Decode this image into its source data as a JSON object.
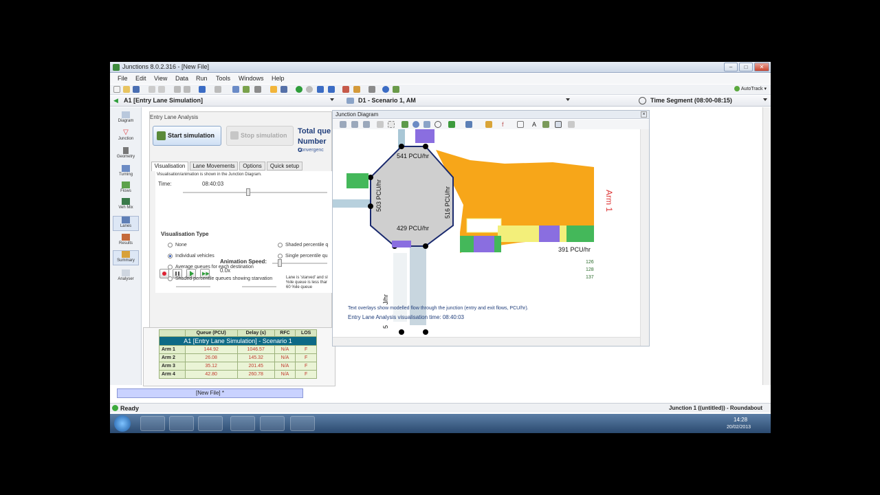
{
  "window": {
    "title": "Junctions 8.0.2.316 - [New File]"
  },
  "menu": [
    "File",
    "Edit",
    "View",
    "Data",
    "Run",
    "Tools",
    "Windows",
    "Help"
  ],
  "toolbar": {
    "autotrack": "AutoTrack"
  },
  "selectors": {
    "analysis": "A1 [Entry Lane Simulation]",
    "scenario": "D1 - Scenario 1, AM",
    "time_segment": "Time Segment (08:00-08:15)"
  },
  "nav": [
    {
      "label": "Diagram"
    },
    {
      "label": "Junction"
    },
    {
      "label": "Geometry"
    },
    {
      "label": "Turning"
    },
    {
      "label": "Flows"
    },
    {
      "label": "Veh Mix"
    },
    {
      "label": "Lanes"
    },
    {
      "label": "Results"
    },
    {
      "label": "Summary"
    },
    {
      "label": "Analyser"
    }
  ],
  "ela": {
    "title": "Entry Lane Analysis",
    "start": "Start simulation",
    "stop": "Stop simulation",
    "total": "Total que",
    "number": "Number o",
    "convergence": "Convergenc",
    "tabs": [
      "Visualisation",
      "Lane Movements",
      "Options",
      "Quick setup"
    ],
    "note": "Visualisation/animation is shown in the Junction Diagram.",
    "time_label": "Time:",
    "time_value": "08:40:03",
    "speed_label": "Animation Speed:",
    "speed_value": "0.0x",
    "vis_type": "Visualisation Type",
    "options": [
      "None",
      "Individual vehicles",
      "Average queues for each destination",
      "Shaded percentile queues showing starvation",
      "Shaded percentile q",
      "Single percentile qu"
    ],
    "starved_note": [
      "Lane is 'starved' and sl",
      "%ile queue is less thar",
      "60 %ile queue"
    ]
  },
  "results": {
    "title": "A1 [Entry Lane Simulation] - Scenario 1",
    "headers": [
      "Queue (PCU)",
      "Delay (s)",
      "RFC",
      "LOS"
    ],
    "rows": [
      {
        "arm": "Arm 1",
        "queue": "144.92",
        "delay": "1046.57",
        "rfc": "N/A",
        "los": "F"
      },
      {
        "arm": "Arm 2",
        "queue": "26.08",
        "delay": "145.32",
        "rfc": "N/A",
        "los": "F"
      },
      {
        "arm": "Arm 3",
        "queue": "35.12",
        "delay": "201.45",
        "rfc": "N/A",
        "los": "F"
      },
      {
        "arm": "Arm 4",
        "queue": "42.80",
        "delay": "260.78",
        "rfc": "N/A",
        "los": "F"
      }
    ]
  },
  "diagram": {
    "title": "Junction Diagram",
    "arm_label": "Arm 1",
    "flows": {
      "top": "541 PCU/hr",
      "left": "503 PCU/hr",
      "right": "516 PCU/hr",
      "bottom": "429 PCU/hr",
      "arm1": "391 PCU/hr",
      "down": "J/hr",
      "down2": "5"
    },
    "lane_counts": [
      "126",
      "128",
      "137"
    ],
    "overlay_note": "Text overlays show modelled flow through the junction (entry and exit flows, PCU/hr).",
    "vis_time": "Entry Lane Analysis visualisation time: 08:40:03",
    "colors": {
      "queue": "#f7a10d",
      "ring": "#cfcfcf",
      "road": "#a9c7d6",
      "lane_green": "#44b85a",
      "lane_purple": "#8a6ee0",
      "lane_yellow": "#f3ef7a"
    }
  },
  "doc_tab": "[New File] *",
  "status": {
    "left": "Ready",
    "right": "Junction 1 ((untitled)) - Roundabout"
  },
  "clock": {
    "time": "14:28",
    "date": "20/02/2013"
  }
}
